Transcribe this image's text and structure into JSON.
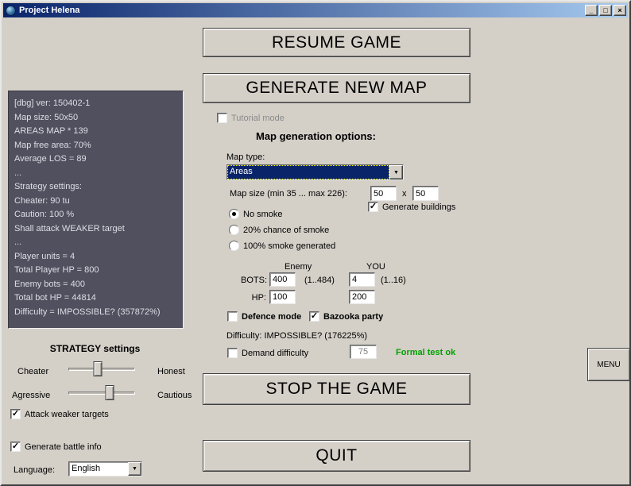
{
  "window": {
    "title": "Project Helena",
    "controls": {
      "minimize": "_",
      "maximize": "□",
      "close": "×"
    }
  },
  "icons": {
    "check": "✓",
    "dropdown_arrow": "▼"
  },
  "buttons": {
    "resume": "RESUME GAME",
    "generate": "GENERATE NEW MAP",
    "stop": "STOP THE GAME",
    "quit": "QUIT",
    "menu": "MENU"
  },
  "debug_panel": {
    "lines": [
      "[dbg] ver: 150402-1",
      "Map size: 50x50",
      "AREAS MAP * 139",
      "Map free area: 70%",
      "Average LOS = 89",
      "...",
      "Strategy settings:",
      "Cheater: 90 tu",
      "Caution: 100 %",
      "Shall attack WEAKER target",
      "...",
      "Player units = 4",
      "Total Player HP = 800",
      "Enemy bots = 400",
      "Total bot HP = 44814",
      "Difficulty = IMPOSSIBLE? (357872%)"
    ]
  },
  "tutorial": {
    "label": "Tutorial mode",
    "checked": false,
    "disabled": true
  },
  "map_options": {
    "heading": "Map generation options:",
    "map_type_label": "Map type:",
    "map_type_value": "Areas",
    "map_size_label": "Map size (min 35 ... max 226):",
    "map_width": "50",
    "size_separator": "x",
    "map_height": "50",
    "generate_buildings": {
      "label": "Generate buildings",
      "checked": true
    },
    "smoke_options": [
      {
        "label": "No smoke",
        "selected": true
      },
      {
        "label": "20% chance of smoke",
        "selected": false
      },
      {
        "label": "100% smoke generated",
        "selected": false
      }
    ],
    "columns": {
      "enemy": "Enemy",
      "you": "YOU"
    },
    "bots_label": "BOTS:",
    "bots_enemy": "400",
    "bots_enemy_range": "(1..484)",
    "bots_you": "4",
    "bots_you_range": "(1..16)",
    "hp_label": "HP:",
    "hp_enemy": "100",
    "hp_you": "200",
    "defence_mode": {
      "label": "Defence mode",
      "checked": false
    },
    "bazooka_party": {
      "label": "Bazooka party",
      "checked": true
    },
    "difficulty_text": "Difficulty: IMPOSSIBLE? (176225%)",
    "demand_difficulty": {
      "label": "Demand difficulty",
      "checked": false
    },
    "demand_value": "75",
    "formal_test": "Formal test ok"
  },
  "strategy": {
    "heading": "STRATEGY settings",
    "slider1": {
      "left": "Cheater",
      "right": "Honest",
      "value_pct": 44
    },
    "slider2": {
      "left": "Agressive",
      "right": "Cautious",
      "value_pct": 62
    },
    "attack_weaker": {
      "label": "Attack weaker targets",
      "checked": true
    }
  },
  "bottom": {
    "battle_info": {
      "label": "Generate battle info",
      "checked": true
    },
    "language_label": "Language:",
    "language_value": "English"
  },
  "colors": {
    "titlebar_start": "#0a246a",
    "titlebar_end": "#a6caf0",
    "debug_panel_bg": "#50505f",
    "selection": "#0a246a",
    "test_ok_green": "#00a000"
  }
}
